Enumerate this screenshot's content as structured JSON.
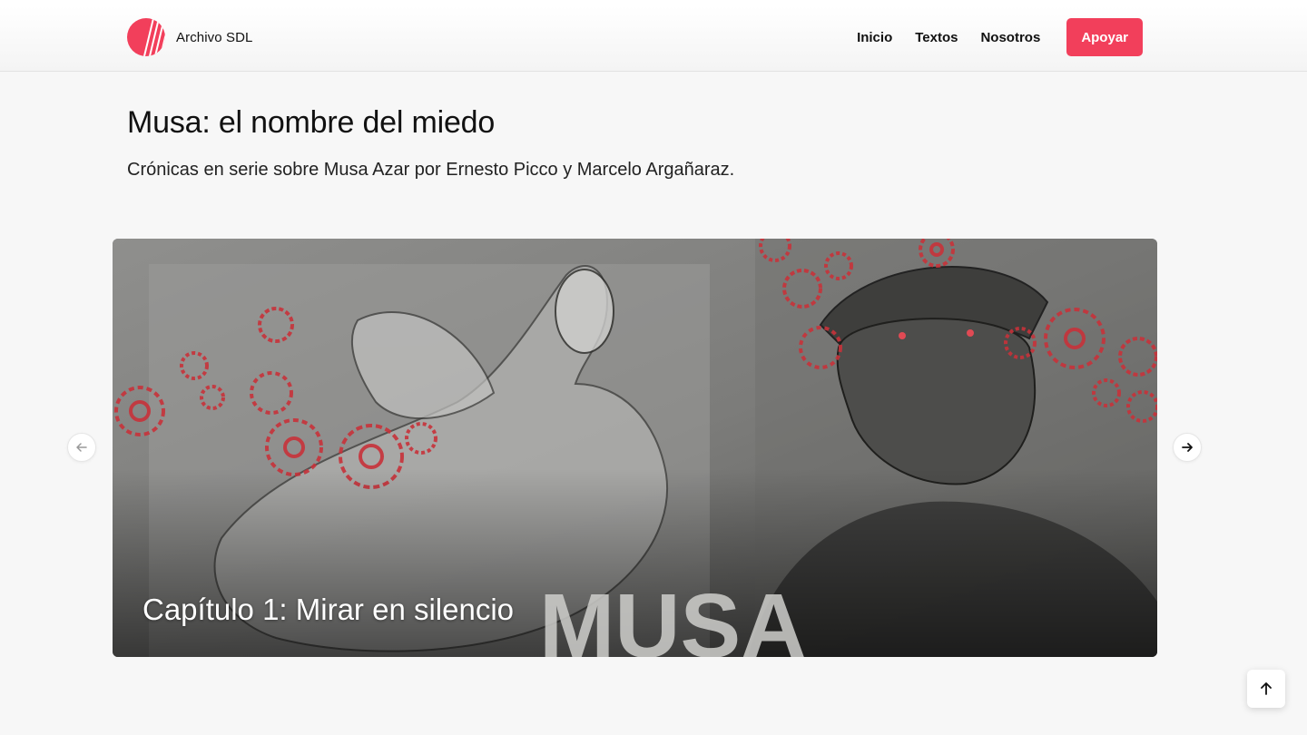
{
  "header": {
    "brand_name": "Archivo SDL",
    "nav": [
      {
        "label": "Inicio"
      },
      {
        "label": "Textos"
      },
      {
        "label": "Nosotros"
      }
    ],
    "cta_label": "Apoyar"
  },
  "main": {
    "title": "Musa: el nombre del miedo",
    "subtitle": "Crónicas en serie sobre Musa Azar por Ernesto Picco y Marcelo Argañaraz."
  },
  "carousel": {
    "slides": [
      {
        "title": "Capítulo 1: Mirar en silencio",
        "art_text": "MUSA"
      }
    ],
    "prev_icon": "arrow-left-icon",
    "next_icon": "arrow-right-icon"
  },
  "scroll_top": {
    "icon": "arrow-up-icon"
  },
  "colors": {
    "accent": "#f23f5b",
    "background": "#f7f7f7",
    "text": "#111111",
    "gear": "#c8323a"
  }
}
